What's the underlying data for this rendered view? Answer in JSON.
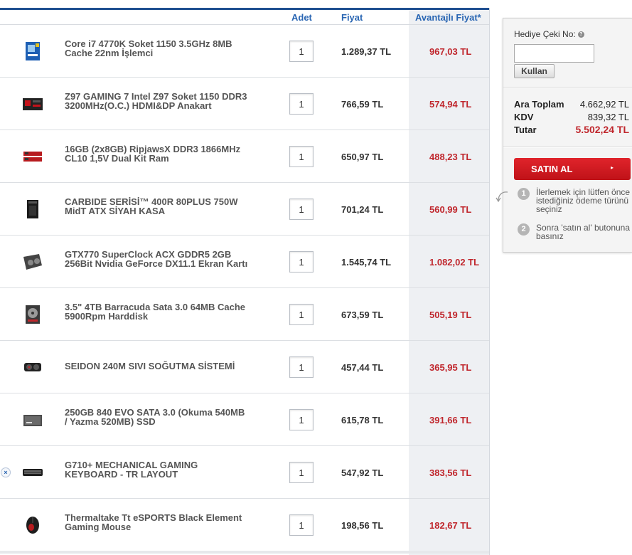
{
  "table": {
    "headers": {
      "qty": "Adet",
      "price": "Fiyat",
      "advantage_price": "Avantajlı Fiyat*"
    },
    "rows": [
      {
        "name": "Core i7 4770K Soket 1150 3.5GHz 8MB Cache 22nm İşlemci",
        "qty": "1",
        "price": "1.289,37 TL",
        "advantage_price": "967,03 TL",
        "icon": "cpu-box-icon"
      },
      {
        "name": "Z97 GAMING 7 Intel Z97 Soket 1150 DDR3 3200MHz(O.C.) HDMI&DP Anakart",
        "qty": "1",
        "price": "766,59 TL",
        "advantage_price": "574,94 TL",
        "icon": "motherboard-icon"
      },
      {
        "name": "16GB (2x8GB) RipjawsX DDR3 1866MHz CL10 1,5V Dual Kit Ram",
        "qty": "1",
        "price": "650,97 TL",
        "advantage_price": "488,23 TL",
        "icon": "ram-icon"
      },
      {
        "name": "CARBIDE SERİSİ™ 400R 80PLUS 750W MidT ATX SİYAH KASA",
        "qty": "1",
        "price": "701,24 TL",
        "advantage_price": "560,99 TL",
        "icon": "pc-case-icon"
      },
      {
        "name": "GTX770 SuperClock ACX GDDR5 2GB 256Bit Nvidia GeForce DX11.1 Ekran Kartı",
        "qty": "1",
        "price": "1.545,74 TL",
        "advantage_price": "1.082,02 TL",
        "icon": "graphics-card-icon"
      },
      {
        "name": "3.5\" 4TB Barracuda Sata 3.0 64MB Cache 5900Rpm Harddisk",
        "qty": "1",
        "price": "673,59 TL",
        "advantage_price": "505,19 TL",
        "icon": "hard-disk-icon"
      },
      {
        "name": "SEIDON 240M SIVI SOĞUTMA SİSTEMİ",
        "qty": "1",
        "price": "457,44 TL",
        "advantage_price": "365,95 TL",
        "icon": "liquid-cooler-icon"
      },
      {
        "name": "250GB 840 EVO SATA 3.0 (Okuma 540MB / Yazma 520MB) SSD",
        "qty": "1",
        "price": "615,78 TL",
        "advantage_price": "391,66 TL",
        "icon": "ssd-icon"
      },
      {
        "name": "G710+ MECHANICAL GAMING KEYBOARD - TR LAYOUT",
        "qty": "1",
        "price": "547,92 TL",
        "advantage_price": "383,56 TL",
        "icon": "keyboard-icon"
      },
      {
        "name": "Thermaltake Tt eSPORTS Black Element Gaming Mouse",
        "qty": "1",
        "price": "198,56 TL",
        "advantage_price": "182,67 TL",
        "icon": "mouse-icon"
      }
    ],
    "remove_icon": "×"
  },
  "panel": {
    "gift_label": "Hediye Çeki No:",
    "help_icon": "?",
    "use_button": "Kullan",
    "subtotal_label": "Ara Toplam",
    "subtotal_value": "4.662,92 TL",
    "tax_label": "KDV",
    "tax_value": "839,32 TL",
    "total_label": "Tutar",
    "total_value": "5.502,24 TL",
    "buy_button": "SATIN AL",
    "buy_arrow": "▸",
    "step1_num": "1",
    "step1_text": "İlerlemek için lütfen önce istediğiniz ödeme türünü seçiniz",
    "step2_num": "2",
    "step2_text": "Sonra 'satın al' butonuna basınız"
  },
  "colors": {
    "accent_blue": "#2a66b3",
    "header_rule": "#1f4f91",
    "price_red": "#c0272d",
    "buy_red": "#d41c22"
  }
}
